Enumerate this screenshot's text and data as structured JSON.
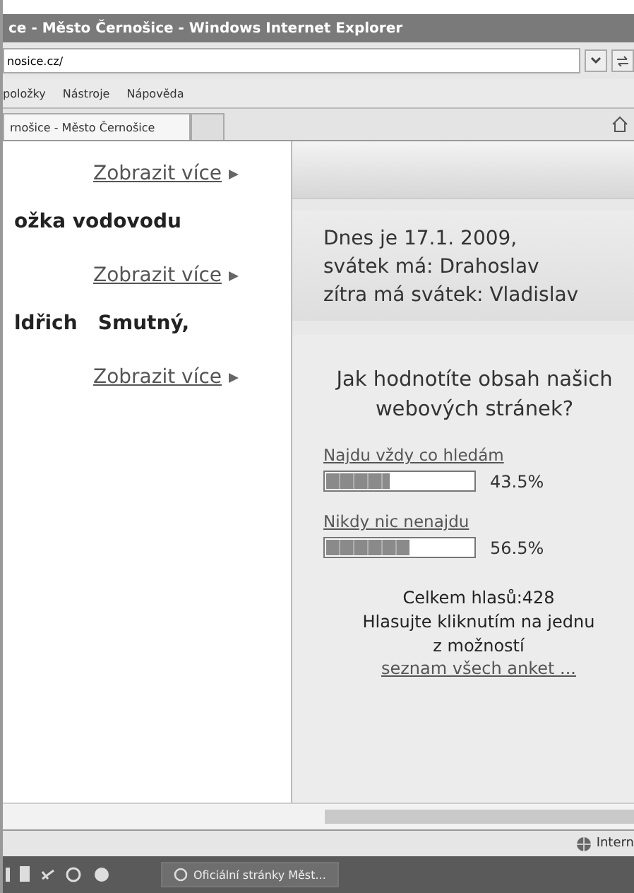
{
  "window": {
    "title": "ce - Město Černošice - Windows Internet Explorer"
  },
  "address_bar": {
    "value": "nosice.cz/"
  },
  "menu": [
    "položky",
    "Nástroje",
    "Nápověda"
  ],
  "tabs": [
    {
      "label": "rnošice - Město Černošice",
      "selected": true
    },
    {
      "selected": false
    }
  ],
  "left_column": [
    {
      "link": "Zobrazit více"
    },
    {
      "heading": "ožka vodovodu",
      "link": "Zobrazit více"
    },
    {
      "heading": "ldřich   Smutný,",
      "link": "Zobrazit více"
    }
  ],
  "date_box": {
    "lines": [
      "Dnes je 17.1. 2009,",
      "svátek má: Drahoslav",
      "zítra má svátek: Vladislav"
    ]
  },
  "poll": {
    "question": "Jak hodnotíte obsah našich webových stránek?",
    "options": [
      {
        "label": "Najdu vždy co hledám",
        "level": 0.435,
        "percent": "43.5%"
      },
      {
        "label": "Nikdy nic nenajdu",
        "level": 0.565,
        "percent": "56.5%"
      }
    ],
    "total": "Celkem hlasů:428",
    "hint": "Hlasujte kliknutím na jednu z možností",
    "link": "seznam všech anket ..."
  },
  "status_bar": {
    "zone": "Intern"
  },
  "taskbar": {
    "button": "Oficiální stránky Měst..."
  }
}
